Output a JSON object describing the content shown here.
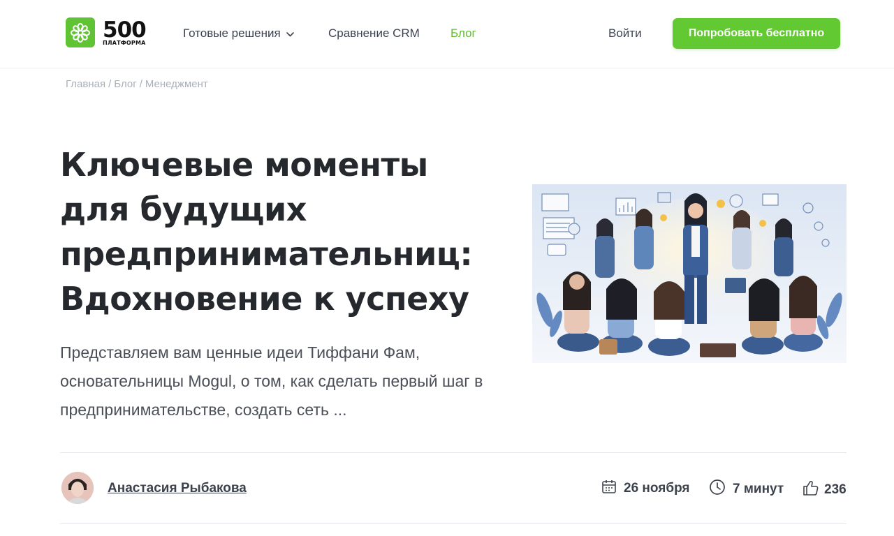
{
  "logo": {
    "number": "500",
    "subtitle": "ПЛАТФОРМА",
    "brand_color": "#5fc334"
  },
  "nav": {
    "items": [
      {
        "label": "Готовые решения",
        "has_dropdown": true,
        "active": false
      },
      {
        "label": "Сравнение CRM",
        "has_dropdown": false,
        "active": false
      },
      {
        "label": "Блог",
        "has_dropdown": false,
        "active": true
      }
    ],
    "login_label": "Войти",
    "cta_label": "Попробовать бесплатно",
    "active_color": "#5fbf2e",
    "cta_color": "#63c933"
  },
  "breadcrumb": {
    "items": [
      "Главная",
      "Блог",
      "Менеджмент"
    ],
    "separator": "/"
  },
  "article": {
    "title_lines": [
      "Ключевые моменты",
      "для будущих",
      "предпринимательниц:",
      "Вдохновение к успеху"
    ],
    "lead": "Представляем вам ценные идеи Тиффани Фам, основательницы Mogul, о том, как сделать первый шаг в предпринимательстве, создать сеть ...",
    "hero_image": "illustration-women-team-meeting"
  },
  "meta": {
    "author": "Анастасия Рыбакова",
    "date": "26 ноября",
    "read_time": "7 минут",
    "likes": "236",
    "icons": [
      "calendar-icon",
      "clock-icon",
      "thumbs-up-icon"
    ]
  }
}
